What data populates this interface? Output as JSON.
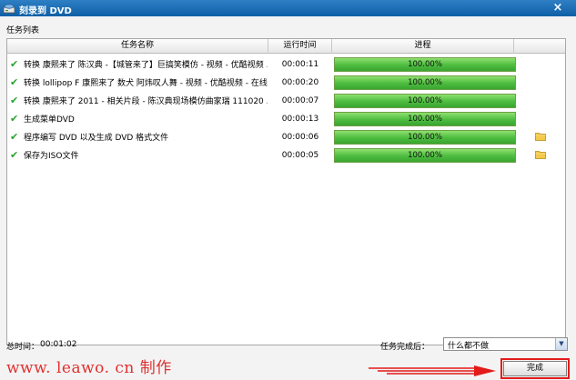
{
  "window": {
    "title": "刻录到 DVD",
    "close_label": "×"
  },
  "section_label": "任务列表",
  "table": {
    "columns": [
      "任务名称",
      "运行时间",
      "进程",
      ""
    ],
    "rows": [
      {
        "name": "转换 康熙来了 陈汉典 -【城管来了】巨搞笑模仿 - 视频 - 优酷视频 ...",
        "time": "00:00:11",
        "progress": 1.0,
        "progress_text": "100.00%",
        "has_folder": false
      },
      {
        "name": "转换 lollipop F 康熙来了 数犬 阿炜叹人舞 - 视频 - 优酷视频 - 在线 ...",
        "time": "00:00:20",
        "progress": 1.0,
        "progress_text": "100.00%",
        "has_folder": false
      },
      {
        "name": "转换 康熙来了 2011 - 相关片段 - 陈汉典现场模仿曲家瑞 111020 ...",
        "time": "00:00:07",
        "progress": 1.0,
        "progress_text": "100.00%",
        "has_folder": false
      },
      {
        "name": "生成菜单DVD",
        "time": "00:00:13",
        "progress": 1.0,
        "progress_text": "100.00%",
        "has_folder": false
      },
      {
        "name": "程序编写 DVD 以及生成 DVD 格式文件",
        "time": "00:00:06",
        "progress": 1.0,
        "progress_text": "100.00%",
        "has_folder": true
      },
      {
        "name": "保存为ISO文件",
        "time": "00:00:05",
        "progress": 1.0,
        "progress_text": "100.00%",
        "has_folder": true
      }
    ]
  },
  "footer": {
    "total_label": "总时间：",
    "total_value": "00:01:02",
    "after_label": "任务完成后：",
    "after_value": "什么都不做",
    "done_label": "完成"
  },
  "watermark": "www. leawo. cn 制作",
  "colors": {
    "titlebar": "#0d5fa6",
    "progress_fill": "#4cbc3f",
    "check": "#27a32d",
    "highlight": "#e31b1b"
  }
}
